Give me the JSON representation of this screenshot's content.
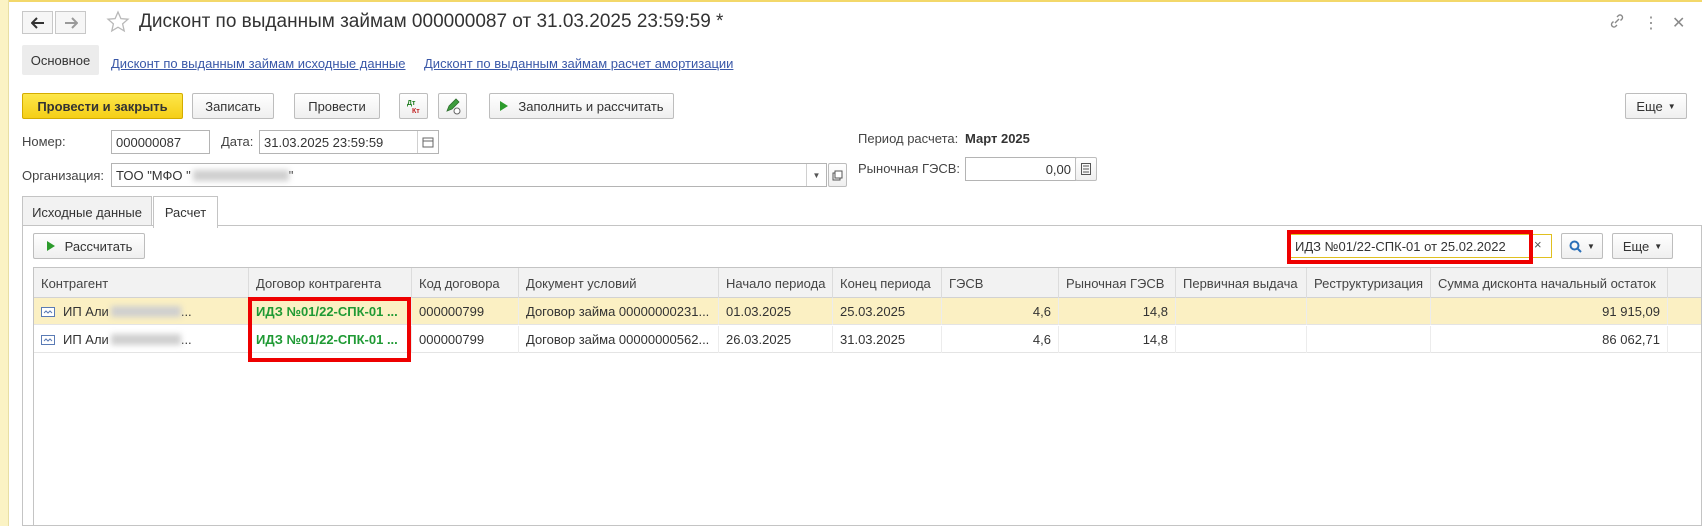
{
  "window": {
    "title": "Дисконт по выданным займам 000000087 от 31.03.2025 23:59:59 *"
  },
  "form_nav": {
    "main_tab": "Основное",
    "links": [
      "Дисконт по выданным займам исходные данные",
      "Дисконт по выданным займам расчет амортизации"
    ]
  },
  "toolbar": {
    "post_and_close": "Провести и закрыть",
    "save": "Записать",
    "post": "Провести",
    "fill_and_calc": "Заполнить и рассчитать",
    "more": "Еще",
    "dt_kt_icon_text": "Дт Кт"
  },
  "fields": {
    "number_label": "Номер:",
    "number_value": "000000087",
    "date_label": "Дата:",
    "date_value": "31.03.2025 23:59:59",
    "org_label": "Организация:",
    "org_value_prefix": "ТОО \"МФО \"",
    "org_value_suffix": "\"",
    "period_label": "Период расчета:",
    "period_value": "Март 2025",
    "market_gesv_label": "Рыночная ГЭСВ:",
    "market_gesv_value": "0,00"
  },
  "tabs": {
    "source_data": "Исходные данные",
    "calculation": "Расчет"
  },
  "calc_panel": {
    "calculate_button": "Рассчитать",
    "search_value": "ИДЗ №01/22-СПК-01  от 25.02.2022",
    "more": "Еще"
  },
  "table": {
    "columns": [
      "Контрагент",
      "Договор контрагента",
      "Код договора",
      "Документ условий",
      "Начало периода",
      "Конец периода",
      "ГЭСВ",
      "Рыночная ГЭСВ",
      "Первичная выдача",
      "Реструктуризация",
      "Сумма дисконта начальный остаток"
    ],
    "rows": [
      [
        "ИП Али",
        "ИДЗ №01/22-СПК-01  ...",
        "000000799",
        "Договор займа 00000000231...",
        "01.03.2025",
        "25.03.2025",
        "4,6",
        "14,8",
        "",
        "",
        "91 915,09"
      ],
      [
        "ИП Али",
        "ИДЗ №01/22-СПК-01  ...",
        "000000799",
        "Договор займа 00000000562...",
        "26.03.2025",
        "31.03.2025",
        "4,6",
        "14,8",
        "",
        "",
        "86 062,71"
      ]
    ]
  }
}
